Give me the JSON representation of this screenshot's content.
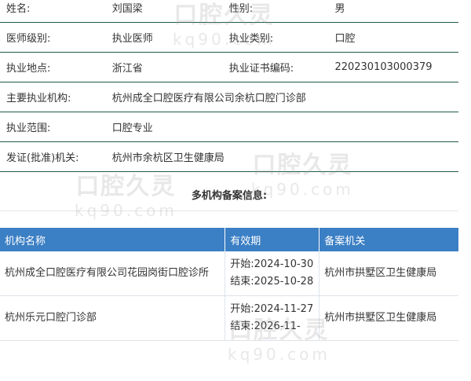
{
  "doctor": {
    "rows": [
      [
        {
          "label": "姓名:",
          "value": "刘国梁"
        },
        {
          "label": "性别:",
          "value": "男"
        }
      ],
      [
        {
          "label": "医师级别:",
          "value": "执业医师"
        },
        {
          "label": "执业类别:",
          "value": "口腔"
        }
      ],
      [
        {
          "label": "执业地点:",
          "value": "浙江省"
        },
        {
          "label": "执业证书编码:",
          "value": "220230103000379"
        }
      ]
    ],
    "main_org": {
      "label": "主要执业机构:",
      "value": "杭州成全口腔医疗有限公司余杭口腔门诊部"
    },
    "scope": {
      "label": "执业范围:",
      "value": "口腔专业"
    },
    "issuer": {
      "label": "发证(批准)机关:",
      "value": "杭州市余杭区卫生健康局"
    }
  },
  "multi_org": {
    "title": "多机构备案信息:",
    "headers": {
      "name": "机构名称",
      "validity": "有效期",
      "authority": "备案机关"
    },
    "rows": [
      {
        "name": "杭州成全口腔医疗有限公司花园岗街口腔诊所",
        "start": "开始:2024-10-30",
        "end": "结束:2025-10-28",
        "authority": "杭州市拱墅区卫生健康局"
      },
      {
        "name": "杭州乐元口腔门诊部",
        "start": "开始:2024-11-27",
        "end": "结束:2026-11-",
        "authority": "杭州市拱墅区卫生健康局"
      }
    ]
  },
  "watermark": {
    "text": "口腔久灵",
    "sub": "kq90.com"
  }
}
